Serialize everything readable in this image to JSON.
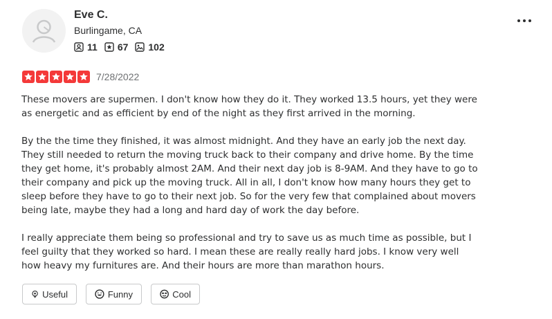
{
  "user": {
    "name": "Eve C.",
    "location": "Burlingame, CA",
    "friends_count": "11",
    "reviews_count": "67",
    "photos_count": "102"
  },
  "review": {
    "rating": 5,
    "date": "7/28/2022",
    "paragraphs": [
      "These movers are supermen. I don't know how they do it. They worked 13.5 hours, yet they were as energetic and as efficient by end of the night as they first arrived in the morning.",
      "By the the time they finished, it was almost midnight. And they have an early job the next day. They still needed to return the moving truck back to their company and drive home. By the time they get home, it's probably almost 2AM. And their next day job is 8-9AM. And they have to go to their company and pick up the moving truck. All in all, I don't know how many hours they get to sleep before they have to go to their next job. So for the very few that complained about movers being late, maybe they had a long and hard day of work the day before.",
      "I really appreciate them being so professional and try to save us as much time as possible, but I feel guilty that they worked so hard. I mean these are really really hard jobs. I know very well how heavy my furnitures are. And their hours are more than marathon hours."
    ]
  },
  "reactions": {
    "useful_label": "Useful",
    "funny_label": "Funny",
    "cool_label": "Cool"
  },
  "colors": {
    "star_red": "#f43939",
    "text": "#2d2e2f",
    "muted": "#6e7072",
    "border": "#c8c9ca"
  },
  "icons": {
    "friends": "friends-icon",
    "reviews": "reviews-star-icon",
    "photos": "photos-icon",
    "more": "more-options-icon"
  }
}
